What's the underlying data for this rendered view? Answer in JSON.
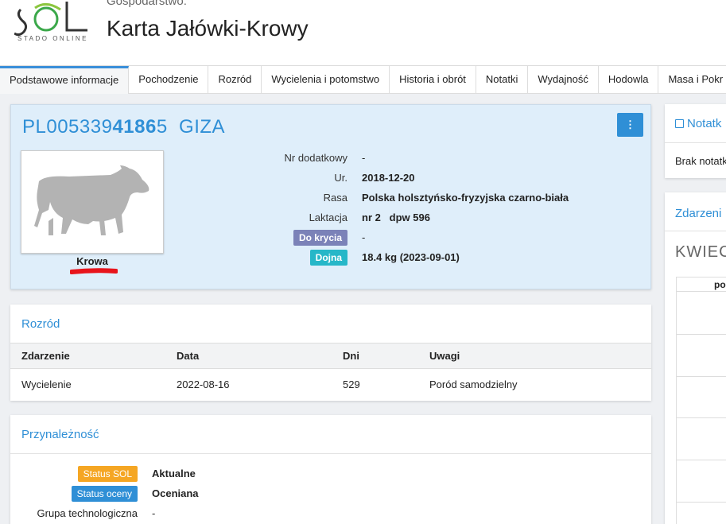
{
  "header": {
    "subtitle": "Gospodarstwo:",
    "title": "Karta Jałówki-Krowy",
    "logo_text": "STADO ONLINE",
    "logo_letters": "SOL"
  },
  "tabs": [
    {
      "label": "Podstawowe informacje",
      "active": true
    },
    {
      "label": "Pochodzenie"
    },
    {
      "label": "Rozród"
    },
    {
      "label": "Wycielenia i potomstwo"
    },
    {
      "label": "Historia i obrót"
    },
    {
      "label": "Notatki"
    },
    {
      "label": "Wydajność"
    },
    {
      "label": "Hodowla"
    },
    {
      "label": "Masa i Pokr"
    }
  ],
  "animal": {
    "id_prefix": "PL005339",
    "id_bold": "4186",
    "id_suffix": "5",
    "name": "GIZA",
    "menu_icon": "⋮",
    "photo_caption": "Krowa",
    "fields": {
      "nr_dodatkowy_label": "Nr dodatkowy",
      "nr_dodatkowy_value": "-",
      "ur_label": "Ur.",
      "ur_value": "2018-12-20",
      "rasa_label": "Rasa",
      "rasa_value": "Polska holsztyńsko-fryzyjska czarno-biała",
      "laktacja_label": "Laktacja",
      "laktacja_value": "nr 2   dpw 596",
      "do_krycia_badge": "Do krycia",
      "do_krycia_value": "-",
      "dojna_badge": "Dojna",
      "dojna_value": "18.4 kg (2023-09-01)"
    }
  },
  "rozrod": {
    "title": "Rozród",
    "columns": [
      "Zdarzenie",
      "Data",
      "Dni",
      "Uwagi"
    ],
    "rows": [
      [
        "Wycielenie",
        "2022-08-16",
        "529",
        "Poród samodzielny"
      ]
    ]
  },
  "przynaleznosc": {
    "title": "Przynależność",
    "status_sol_badge": "Status SOL",
    "status_sol_value": "Aktualne",
    "status_oceny_badge": "Status oceny",
    "status_oceny_value": "Oceniana",
    "grupa_label": "Grupa technologiczna",
    "grupa_value": "-"
  },
  "right": {
    "notatki_title": "Notatk",
    "notatki_empty": "Brak notatk",
    "zdarzenia_title": "Zdarzeni",
    "month": "KWIEC",
    "col_header": "por"
  },
  "colors": {
    "accent": "#2f8fd6",
    "badge_krycia": "#7b82b8",
    "badge_dojna": "#26b7c8",
    "badge_sol": "#f5a623",
    "badge_oceny": "#2f8fd6"
  }
}
